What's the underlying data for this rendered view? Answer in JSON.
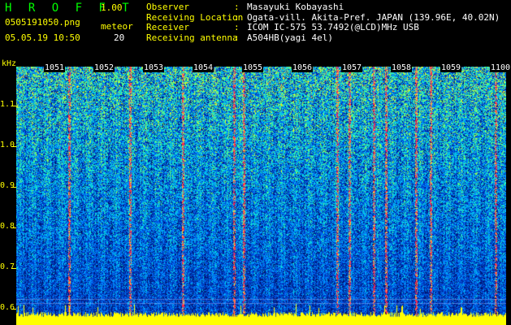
{
  "app": {
    "logo": "H R O F F T",
    "version": "1.00"
  },
  "capture": {
    "filename": "0505191050.png",
    "datetime": "05.05.19 10:50"
  },
  "meteor": {
    "label": "meteor",
    "count": "20"
  },
  "info": [
    {
      "key": "Observer",
      "sep": ":",
      "value": "Masayuki Kobayashi"
    },
    {
      "key": "Receiving Location",
      "sep": ":",
      "value": "Ogata-vill. Akita-Pref. JAPAN (139.96E, 40.02N)"
    },
    {
      "key": "Receiver",
      "sep": ":",
      "value": "ICOM IC-575 53.7492(@LCD)MHz USB"
    },
    {
      "key": "Receiving antenna",
      "sep": ":",
      "value": "A504HB(yagi 4el)"
    }
  ],
  "axis": {
    "y_unit": "kHz",
    "y_ticks": [
      "1.1",
      "1.0",
      "0.9",
      "0.8",
      "0.7",
      "0.6"
    ],
    "x_ticks": [
      "1051",
      "1052",
      "1053",
      "1054",
      "1055",
      "1056",
      "1057",
      "1058",
      "1059",
      "1100"
    ]
  },
  "colors": {
    "background": "#000000",
    "text_primary": "#ffff00",
    "text_secondary": "#ffffff",
    "logo": "#00ff00",
    "noise_floor": "#ffff00"
  }
}
